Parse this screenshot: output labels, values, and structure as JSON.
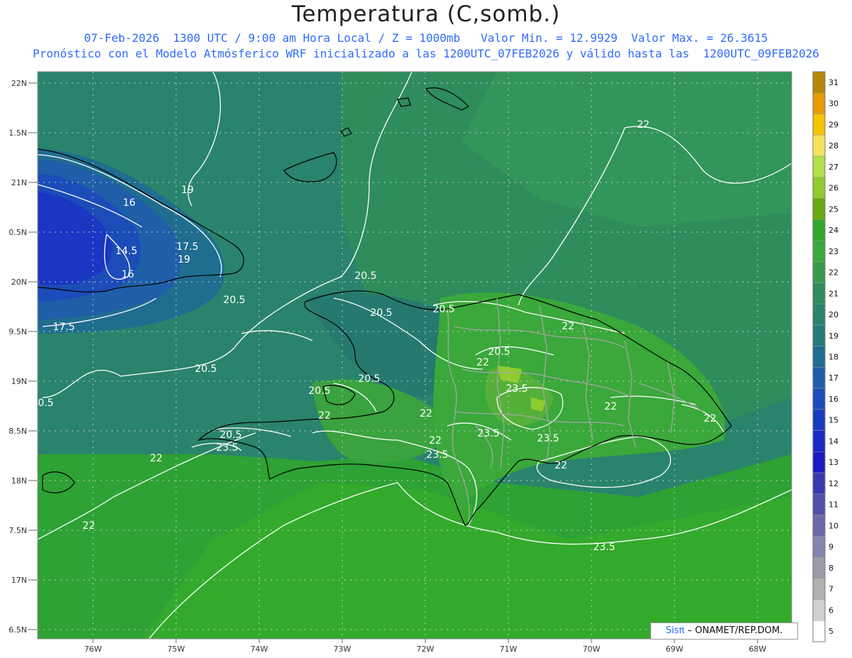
{
  "title": "Temperatura (C,somb.)",
  "subtitle_line1": "07-Feb-2026  1300 UTC / 9:00 am Hora Local / Z = 1000mb   Valor Min. = 12.9929  Valor Max. = 26.3615",
  "subtitle_line2": "Pronóstico con el Modelo Atmósferico WRF inicializado a las 1200UTC_07FEB2026 y válido hasta las  1200UTC_09FEB2026",
  "credit": {
    "brand": "Sisπ",
    "text": "– ONAMET/REP.DOM."
  },
  "axes": {
    "lat_labels": [
      "22N",
      "1.5N",
      "21N",
      "0.5N",
      "20N",
      "9.5N",
      "19N",
      "8.5N",
      "18N",
      "7.5N",
      "17N",
      "6.5N"
    ],
    "lon_labels": [
      "76W",
      "75W",
      "74W",
      "73W",
      "72W",
      "71W",
      "70W",
      "69W",
      "68W"
    ]
  },
  "colorbar": {
    "levels": [
      "31",
      "30",
      "29",
      "28",
      "27",
      "26",
      "25",
      "24",
      "23",
      "22",
      "21",
      "20",
      "19",
      "18",
      "17",
      "16",
      "15",
      "14",
      "13",
      "12",
      "11",
      "10",
      "9",
      "8",
      "7",
      "6",
      "5"
    ],
    "colors": [
      "#b8860b",
      "#e69a00",
      "#f5c400",
      "#f7e35a",
      "#b5e04a",
      "#8fcc2e",
      "#6aa80f",
      "#2fa82a",
      "#3aa83a",
      "#3a9a4a",
      "#2f8c5c",
      "#2a836c",
      "#257a7a",
      "#1f6d8f",
      "#1f5ea8",
      "#1c4cb8",
      "#1a3ac0",
      "#1a28c4",
      "#1c1ac0",
      "#3838b0",
      "#5050a8",
      "#6a6aa8",
      "#8484b0",
      "#9a9aa8",
      "#b0b0b0",
      "#d0d0d0",
      "#ffffff"
    ]
  },
  "contour_labels": [
    {
      "text": "22"
    },
    {
      "text": "19"
    },
    {
      "text": "16"
    },
    {
      "text": "17.5"
    },
    {
      "text": "14.5"
    },
    {
      "text": "19"
    },
    {
      "text": "16"
    },
    {
      "text": "20.5"
    },
    {
      "text": "20.5"
    },
    {
      "text": "17.5"
    },
    {
      "text": "20.5"
    },
    {
      "text": "20.5"
    },
    {
      "text": "20.5"
    },
    {
      "text": "22"
    },
    {
      "text": "20.5"
    },
    {
      "text": "22"
    },
    {
      "text": "20.5"
    },
    {
      "text": "23.5"
    },
    {
      "text": "20.5"
    },
    {
      "text": "22"
    },
    {
      "text": "22"
    },
    {
      "text": "23.5"
    },
    {
      "text": "20.5"
    },
    {
      "text": "22"
    },
    {
      "text": "22"
    },
    {
      "text": "23.5"
    },
    {
      "text": "23.5"
    },
    {
      "text": "23.5"
    },
    {
      "text": "22"
    },
    {
      "text": "22"
    },
    {
      "text": "23.5"
    },
    {
      "text": "22"
    },
    {
      "text": "22"
    },
    {
      "text": "20.5"
    }
  ]
}
